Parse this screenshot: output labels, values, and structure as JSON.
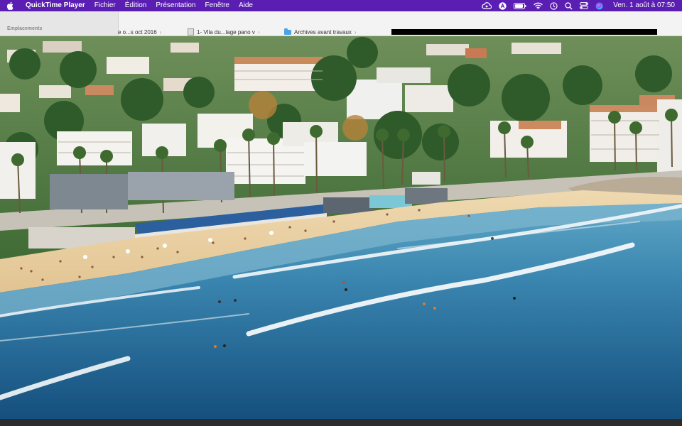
{
  "menubar": {
    "app_name": "QuickTime Player",
    "menus": [
      "Fichier",
      "Édition",
      "Présentation",
      "Fenêtre",
      "Aide"
    ],
    "clock": "Ven. 1 août à 07:50",
    "status_icons": [
      "cloud-icon",
      "a-circle-icon",
      "battery-icon",
      "wifi-icon",
      "timer-icon",
      "search-icon",
      "control-center-icon",
      "siri-icon"
    ]
  },
  "finder": {
    "sidebar_section": "Emplacements",
    "tabs": [
      {
        "label": "e o...s oct 2016"
      },
      {
        "label": "1- Vlla du...lage pano v"
      },
      {
        "label": "Archives avant travaux"
      }
    ]
  },
  "colors": {
    "menubar": "#5a1fb2",
    "sea_deep": "#1c5d8a",
    "sea_shallow": "#5ea5c4",
    "sand": "#e8cfa3"
  }
}
